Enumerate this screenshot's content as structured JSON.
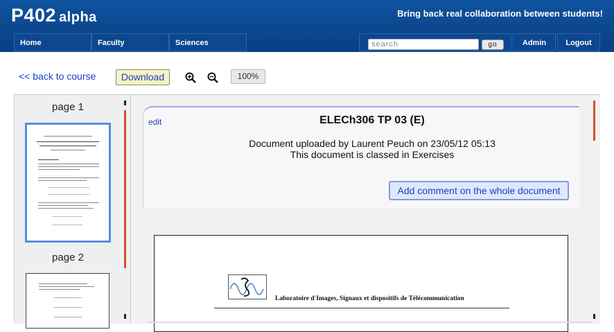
{
  "header": {
    "logo_main": "P402",
    "logo_sub": "alpha",
    "tagline": "Bring back real collaboration between students!"
  },
  "nav": {
    "items": [
      "Home",
      "Faculty",
      "Sciences"
    ],
    "search_placeholder": "search",
    "search_button": "go",
    "admin": "Admin",
    "logout": "Logout"
  },
  "toolbar": {
    "back_label": "<< back to course",
    "download_label": "Download",
    "zoom_in_icon": "zoom-in-icon",
    "zoom_out_icon": "zoom-out-icon",
    "zoom_level": "100%"
  },
  "thumbnails": [
    {
      "label": "page 1"
    },
    {
      "label": "page 2"
    }
  ],
  "document": {
    "edit_label": "edit",
    "title": "ELECh306 TP 03 (E)",
    "uploaded_text": "Document uploaded by Laurent Peuch on 23/05/12 05:13",
    "classed_text": "This document is classed in Exercises",
    "add_comment_label": "Add comment on the whole document",
    "page_header_text": "Laboratoire d'Images, Signaux et dispositifs de Télécommunication"
  },
  "colors": {
    "header_bg": "#0f53a0",
    "link": "#1a3ec8",
    "scroll_accent": "#d05030",
    "selected_thumb": "#5b8be0"
  }
}
